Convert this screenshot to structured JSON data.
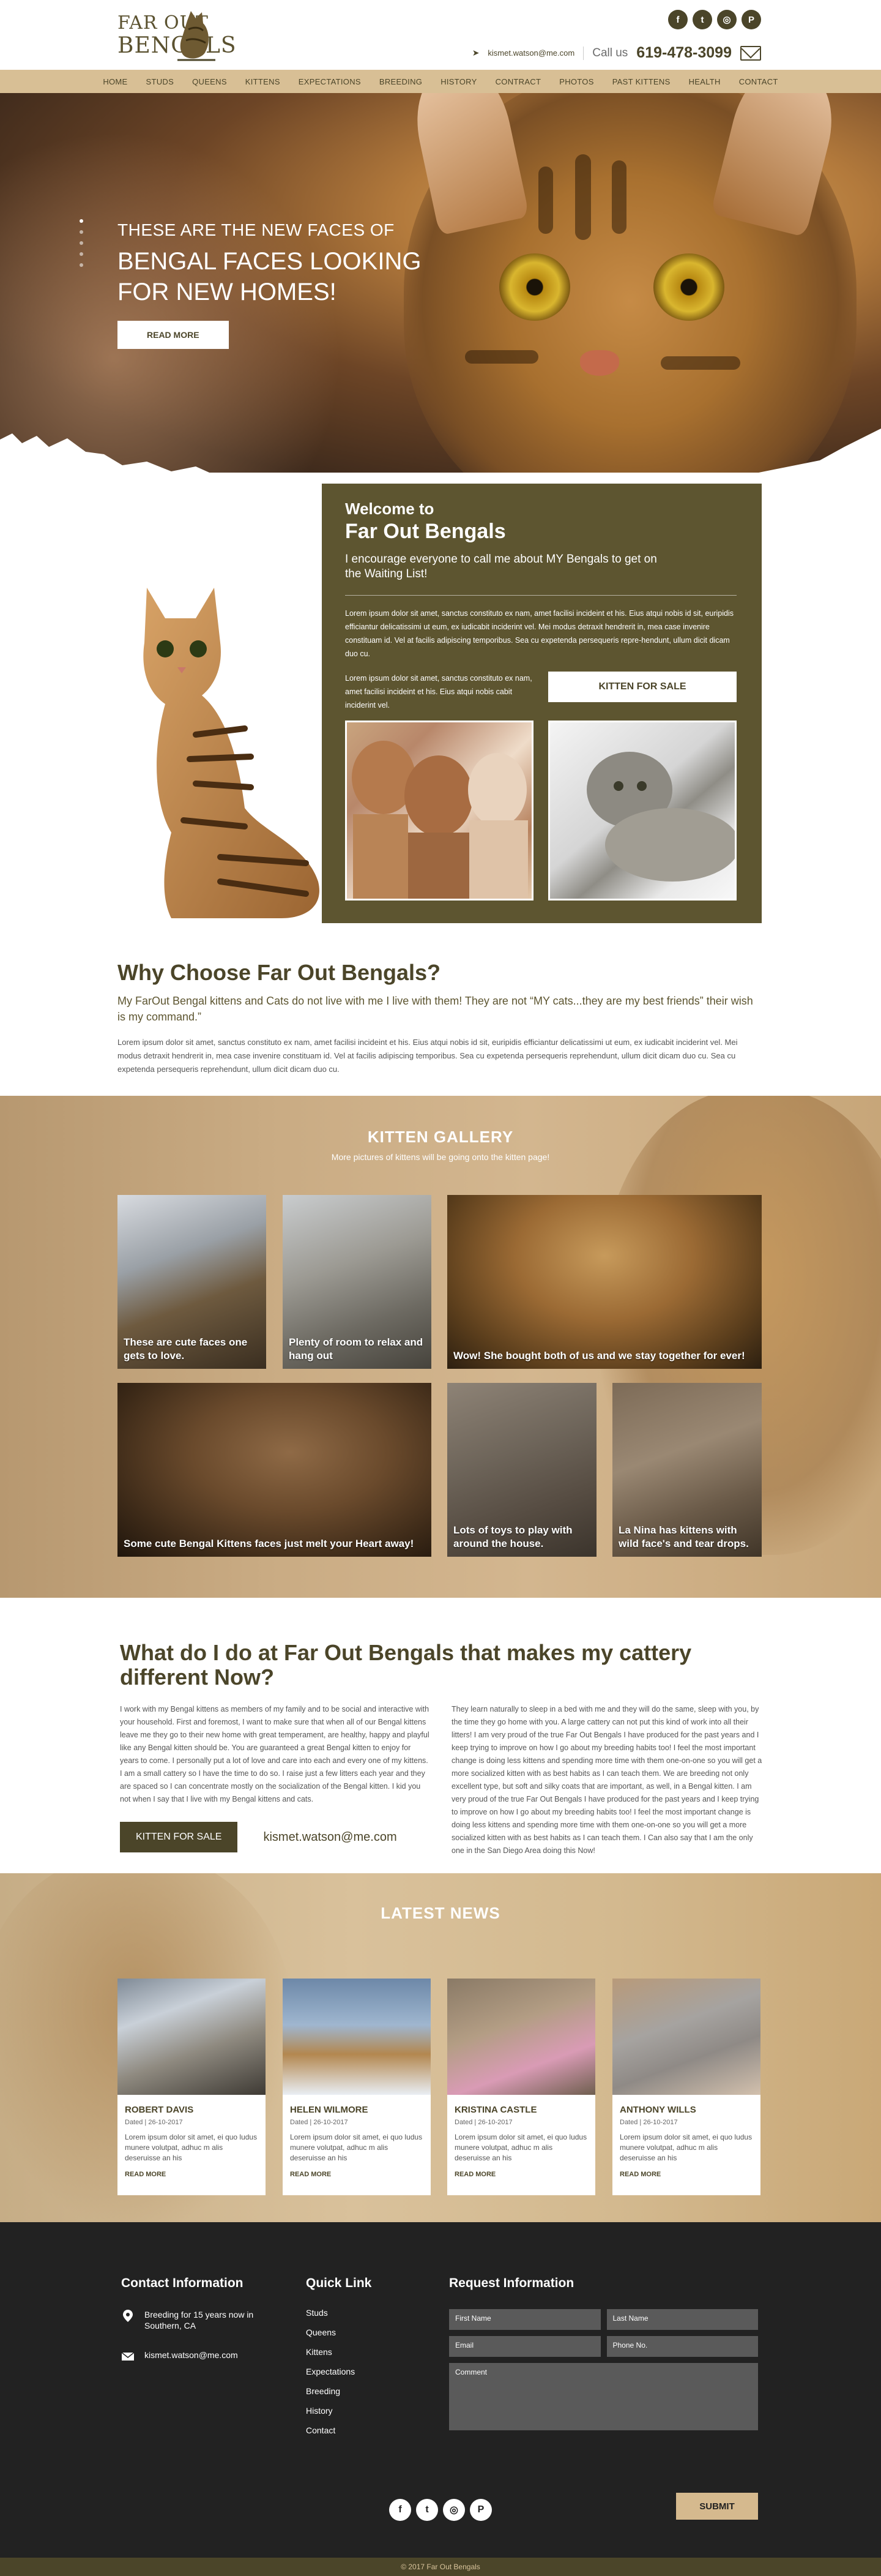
{
  "header": {
    "logo_line1": "FAR OUT",
    "logo_line2": "BENGALS",
    "social_icons": [
      "facebook-icon",
      "twitter-icon",
      "instagram-icon",
      "pinterest-icon"
    ],
    "social_glyphs": [
      "f",
      "t",
      "◎",
      "P"
    ],
    "email": "kismet.watson@me.com",
    "call_label": "Call us",
    "phone": "619-478-3099"
  },
  "nav": [
    "Home",
    "Studs",
    "Queens",
    "Kittens",
    "Expectations",
    "Breeding",
    "History",
    "Contract",
    "Photos",
    "Past Kittens",
    "Health",
    "Contact"
  ],
  "hero": {
    "subtitle": "These are the new faces of",
    "title": "Bengal faces looking for new homes!",
    "button": "Read More"
  },
  "welcome": {
    "line1": "Welcome to",
    "line2": "Far Out Bengals",
    "lead": "I encourage everyone to call me about MY Bengals to get on the Waiting List!",
    "p1": "Lorem ipsum dolor sit amet, sanctus constituto ex nam, amet facilisi incideint et his. Eius atqui nobis id sit, euripidis efficiantur delicatissimi ut eum, ex iudicabit inciderint vel. Mei modus detraxit hendrerit in, mea case invenire constituam id. Vel at facilis adipiscing temporibus. Sea cu expetenda persequeris repre-hendunt, ullum dicit dicam duo cu.",
    "p2": "Lorem ipsum dolor sit amet, sanctus constituto ex nam, amet facilisi incideint et his. Eius atqui nobis cabit inciderint vel.",
    "button": "Kitten for sale"
  },
  "why": {
    "title": "Why Choose Far Out Bengals?",
    "lead": "My FarOut Bengal kittens and Cats do not live with me I live with them! They are not “MY cats...they are my best friends” their wish is my command.”",
    "body": "Lorem ipsum dolor sit amet, sanctus constituto ex nam, amet facilisi incideint et his. Eius atqui nobis id sit, euripidis efficiantur delicatissimi ut eum, ex iudicabit inciderint vel. Mei modus detraxit hendrerit in, mea case invenire constituam id. Vel at facilis adipiscing temporibus. Sea cu expetenda persequeris reprehendunt, ullum dicit dicam duo cu. Sea cu expetenda persequeris reprehendunt, ullum dicit dicam duo cu."
  },
  "gallery": {
    "title": "Kitten Gallery",
    "subtitle": "More pictures of kittens will be going onto the kitten page!",
    "items": [
      {
        "caption": "These are cute faces one gets to love."
      },
      {
        "caption": "Plenty of room to relax and hang out"
      },
      {
        "caption": "Wow! She bought both of us and we stay together for ever!"
      },
      {
        "caption": "Some cute Bengal Kittens faces just melt your Heart away!"
      },
      {
        "caption": "Lots of toys to play with around the house."
      },
      {
        "caption": "La Nina has kittens with wild face's and tear drops."
      }
    ]
  },
  "what": {
    "title": "What do I do at Far Out Bengals that makes my cattery different Now?",
    "col1": "I work with my Bengal kittens as members of my family and to be social and interactive with your household. First and foremost, I want to make sure that when all of our Bengal kittens leave me they go to their new home with great temperament, are healthy, happy and playful like any Bengal kitten should be. You are guaranteed a great Bengal kitten to enjoy for years to come. I personally put a lot of love and care into each and every one of my kittens. I am a small cattery so I have the time to do so. I raise just a few litters each year and they are spaced so I can concentrate mostly on the socialization of the Bengal kitten. I kid you not when I say that I live with my Bengal kittens and cats.",
    "col2": "They learn naturally to sleep in a bed with me and they will do the same, sleep with you, by the time they go home with you. A large cattery can not put this kind of work into all their litters! I am very proud of the true Far Out Bengals I have produced for the past years and I keep trying to improve on how I go about my breeding habits too! I feel the most important change is doing less kittens and spending more time with them one-on-one so you will get a more socialized kitten with as best habits as I can teach them. We are breeding not only excellent type, but soft and silky coats that are important, as well, in a Bengal kitten. I am very proud of the true Far Out Bengals I have produced for the past years and I keep trying to improve on how I go about my breeding habits too! I feel the most important change is doing less kittens and spending more time with them one-on-one so you will get a more socialized kitten with as best habits as I can teach them. I Can also say that I am the only one in the San Diego Area doing this Now!",
    "button": "Kitten for sale",
    "email": "kismet.watson@me.com"
  },
  "news": {
    "title": "Latest News",
    "items": [
      {
        "name": "Robert Davis",
        "date": "Dated  |  26-10-2017",
        "body": "Lorem ipsum dolor sit amet, ei quo ludus munere volutpat, adhuc m alis deseruisse an his",
        "more": "Read more"
      },
      {
        "name": "Helen Wilmore",
        "date": "Dated  |  26-10-2017",
        "body": "Lorem ipsum dolor sit amet, ei quo ludus munere volutpat, adhuc m alis deseruisse an his",
        "more": "Read more"
      },
      {
        "name": "Kristina Castle",
        "date": "Dated  |  26-10-2017",
        "body": "Lorem ipsum dolor sit amet, ei quo ludus munere volutpat, adhuc m alis deseruisse an his",
        "more": "Read more"
      },
      {
        "name": "Anthony Wills",
        "date": "Dated  |  26-10-2017",
        "body": "Lorem ipsum dolor sit amet, ei quo ludus munere volutpat, adhuc m alis deseruisse an his",
        "more": "Read more"
      }
    ]
  },
  "footer": {
    "contact_title": "Contact Information",
    "breeding": "Breeding for 15 years now in Southern, CA",
    "email": "kismet.watson@me.com",
    "links_title": "Quick Link",
    "links": [
      "Studs",
      "Queens",
      "Kittens",
      "Expectations",
      "Breeding",
      "History",
      "Contact"
    ],
    "form_title": "Request Information",
    "first_name": "First Name",
    "last_name": "Last Name",
    "email_ph": "Email",
    "phone_ph": "Phone No.",
    "comment": "Comment",
    "submit": "Submit",
    "copyright": "© 2017  Far Out Bengals"
  }
}
